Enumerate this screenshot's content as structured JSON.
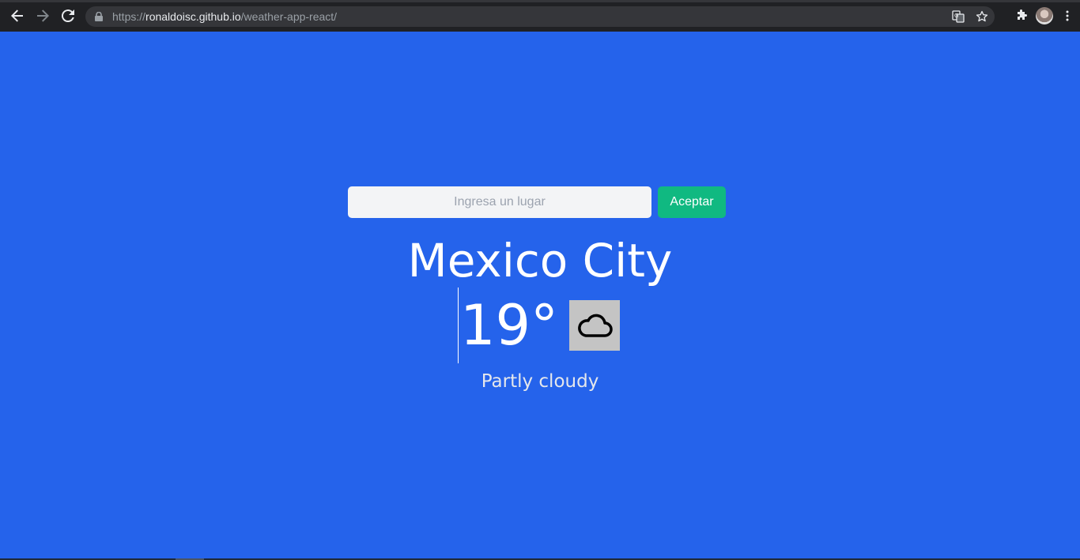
{
  "browser": {
    "url_scheme": "https://",
    "url_host": "ronaldoisc.github.io",
    "url_path": "/weather-app-react/",
    "icons": [
      "back-arrow-icon",
      "forward-arrow-icon",
      "reload-icon",
      "lock-icon",
      "translate-icon",
      "star-icon",
      "extensions-icon",
      "profile-avatar",
      "kebab-menu-icon"
    ]
  },
  "search": {
    "placeholder": "Ingresa un lugar",
    "value": "",
    "button_label": "Aceptar"
  },
  "weather": {
    "city": "Mexico City",
    "temperature": "19°",
    "condition": "Partly cloudy",
    "icon": "cloud-icon"
  },
  "colors": {
    "background": "#2563eb",
    "button": "#10b981",
    "input_bg": "#f3f4f6",
    "icon_bg": "#c4c4c4"
  }
}
